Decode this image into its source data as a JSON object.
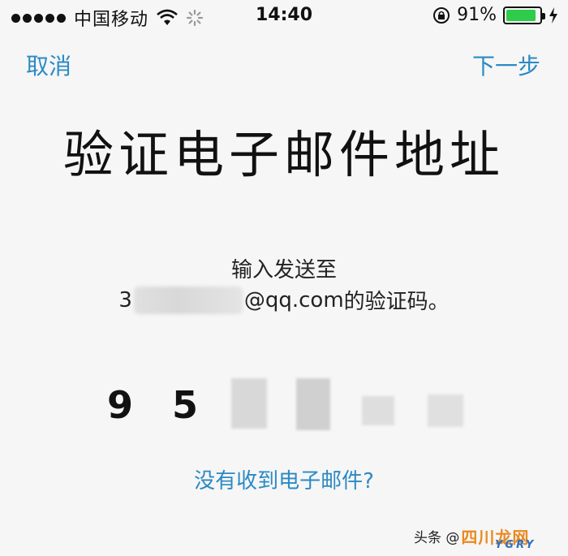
{
  "status_bar": {
    "carrier": "中国移动",
    "time": "14:40",
    "battery_percent": "91%",
    "battery_level": 0.91,
    "icons": [
      "signal-dots-icon",
      "wifi-icon",
      "loading-spinner-icon",
      "rotation-lock-icon",
      "battery-icon",
      "charging-bolt-icon"
    ]
  },
  "nav": {
    "cancel_label": "取消",
    "next_label": "下一步"
  },
  "title": "验证电子邮件地址",
  "prompt": {
    "line1": "输入发送至",
    "email_prefix": "3",
    "email_suffix": "@qq.com",
    "line2_tail": " 的验证码。"
  },
  "code": {
    "digits": [
      "9",
      "5"
    ]
  },
  "no_email_link": "没有收到电子邮件?",
  "watermark": {
    "source": "头条 @",
    "logo": "四川龙网",
    "latin": "YGRY"
  },
  "colors": {
    "accent": "#2b8ac4",
    "battery": "#2ecc4a",
    "background": "#f6f6f6"
  }
}
